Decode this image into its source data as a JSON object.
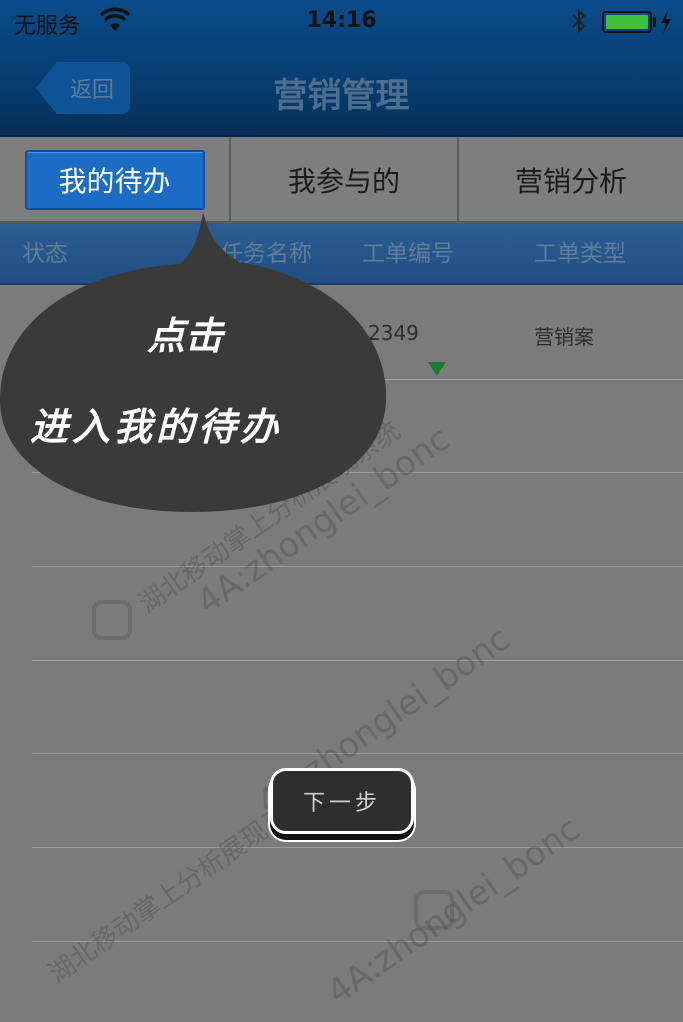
{
  "status_bar": {
    "carrier": "无服务",
    "time": "14:16",
    "battery_level": 1.0,
    "icons": [
      "wifi-icon",
      "bluetooth-icon",
      "battery-icon",
      "charging-icon"
    ]
  },
  "nav": {
    "back_label": "返回",
    "title": "营销管理"
  },
  "tabs": [
    {
      "label": "我的待办",
      "active": true
    },
    {
      "label": "我参与的",
      "active": false
    },
    {
      "label": "营销分析",
      "active": false
    }
  ],
  "table": {
    "headers": [
      "状态",
      "任务名称",
      "工单编号",
      "工单类型"
    ],
    "rows": [
      {
        "number": "2349",
        "type": "营销案"
      }
    ]
  },
  "guide": {
    "line1": "点击",
    "line2": "进入我的待办",
    "next_label": "下一步"
  },
  "watermark": {
    "text1": "4A:zhonglei_bonc",
    "text2": "湖北移动掌上分析展现系统"
  },
  "colors": {
    "nav_bg": "#063a6c",
    "active_tab": "#1b6cc4",
    "overlay": "#7b7b7b",
    "bubble": "#3a3a3a",
    "battery": "#3ec13e"
  }
}
